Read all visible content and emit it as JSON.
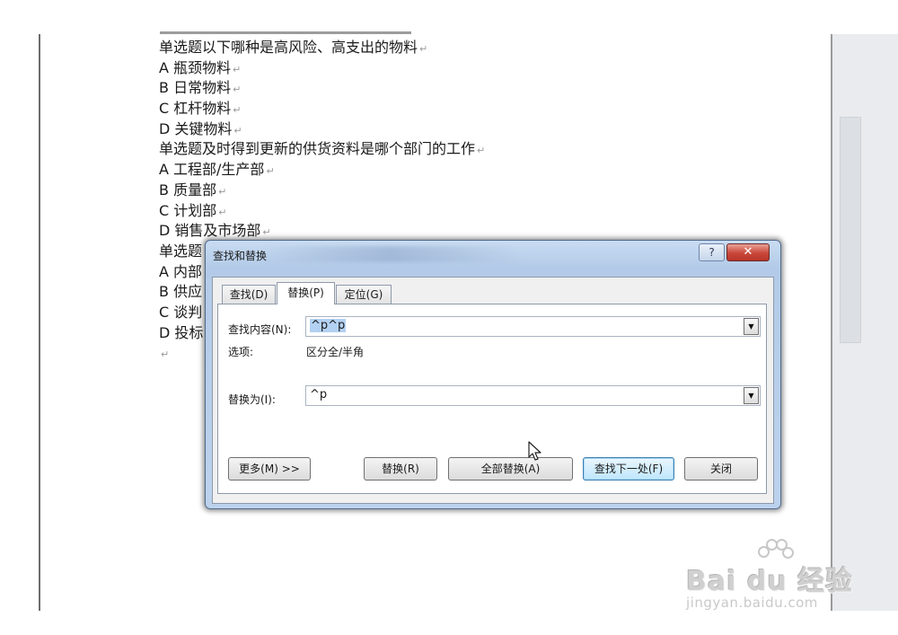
{
  "document": {
    "lines": [
      "单选题以下哪种是高风险、高支出的物料",
      "A 瓶颈物料",
      "B 日常物料",
      "C 杠杆物料",
      "D 关键物料",
      "单选题及时得到更新的供货资料是哪个部门的工作",
      "A 工程部/生产部",
      "B 质量部",
      "C 计划部",
      "D 销售及市场部",
      "单选题",
      "A 内部",
      "B 供应",
      "C 谈判",
      "D 投标",
      ""
    ],
    "paragraph_mark": "↵"
  },
  "dialog": {
    "title": "查找和替换",
    "help_label": "?",
    "close_label": "✕",
    "tabs": [
      {
        "label": "查找(D)",
        "active": false
      },
      {
        "label": "替换(P)",
        "active": true
      },
      {
        "label": "定位(G)",
        "active": false
      }
    ],
    "find_label": "查找内容(N):",
    "find_value": "^p^p",
    "options_label": "选项:",
    "options_value": "区分全/半角",
    "replace_label": "替换为(I):",
    "replace_value": "^p",
    "buttons": {
      "more": "更多(M) >>",
      "replace": "替换(R)",
      "replace_all": "全部替换(A)",
      "find_next": "查找下一处(F)",
      "close": "关闭"
    }
  },
  "watermark": {
    "brand": "Bai du 经验",
    "url": "jingyan.baidu.com"
  },
  "colors": {
    "dialog_frame": "#b3cbe8",
    "close_red": "#c8473a",
    "selection": "#b3d1f3"
  }
}
